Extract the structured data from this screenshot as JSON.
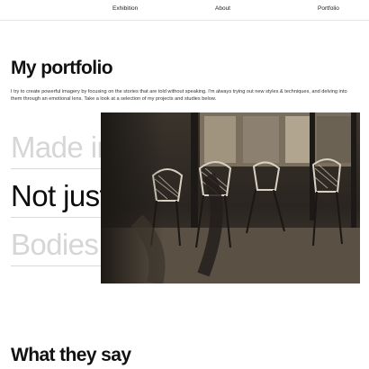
{
  "nav": {
    "items": [
      "Exhibition",
      "About",
      "Portfolio"
    ]
  },
  "header": {
    "title": "My portfolio",
    "intro": "I try to create powerful imagery by focusing on the stories that are told without speaking. I'm always trying out new styles & techniques, and delving into them through an emotional lens. Take a look at a selection of my projects and studies below."
  },
  "projects": [
    {
      "label": "Made in"
    },
    {
      "label": "Not just things"
    },
    {
      "label": "Bodies"
    }
  ],
  "testimonials": {
    "title": "What they say"
  },
  "colors": {
    "active_text": "#0d0d0d",
    "inactive_text": "#d6d6d6",
    "photo_tone": "#2a2621"
  }
}
